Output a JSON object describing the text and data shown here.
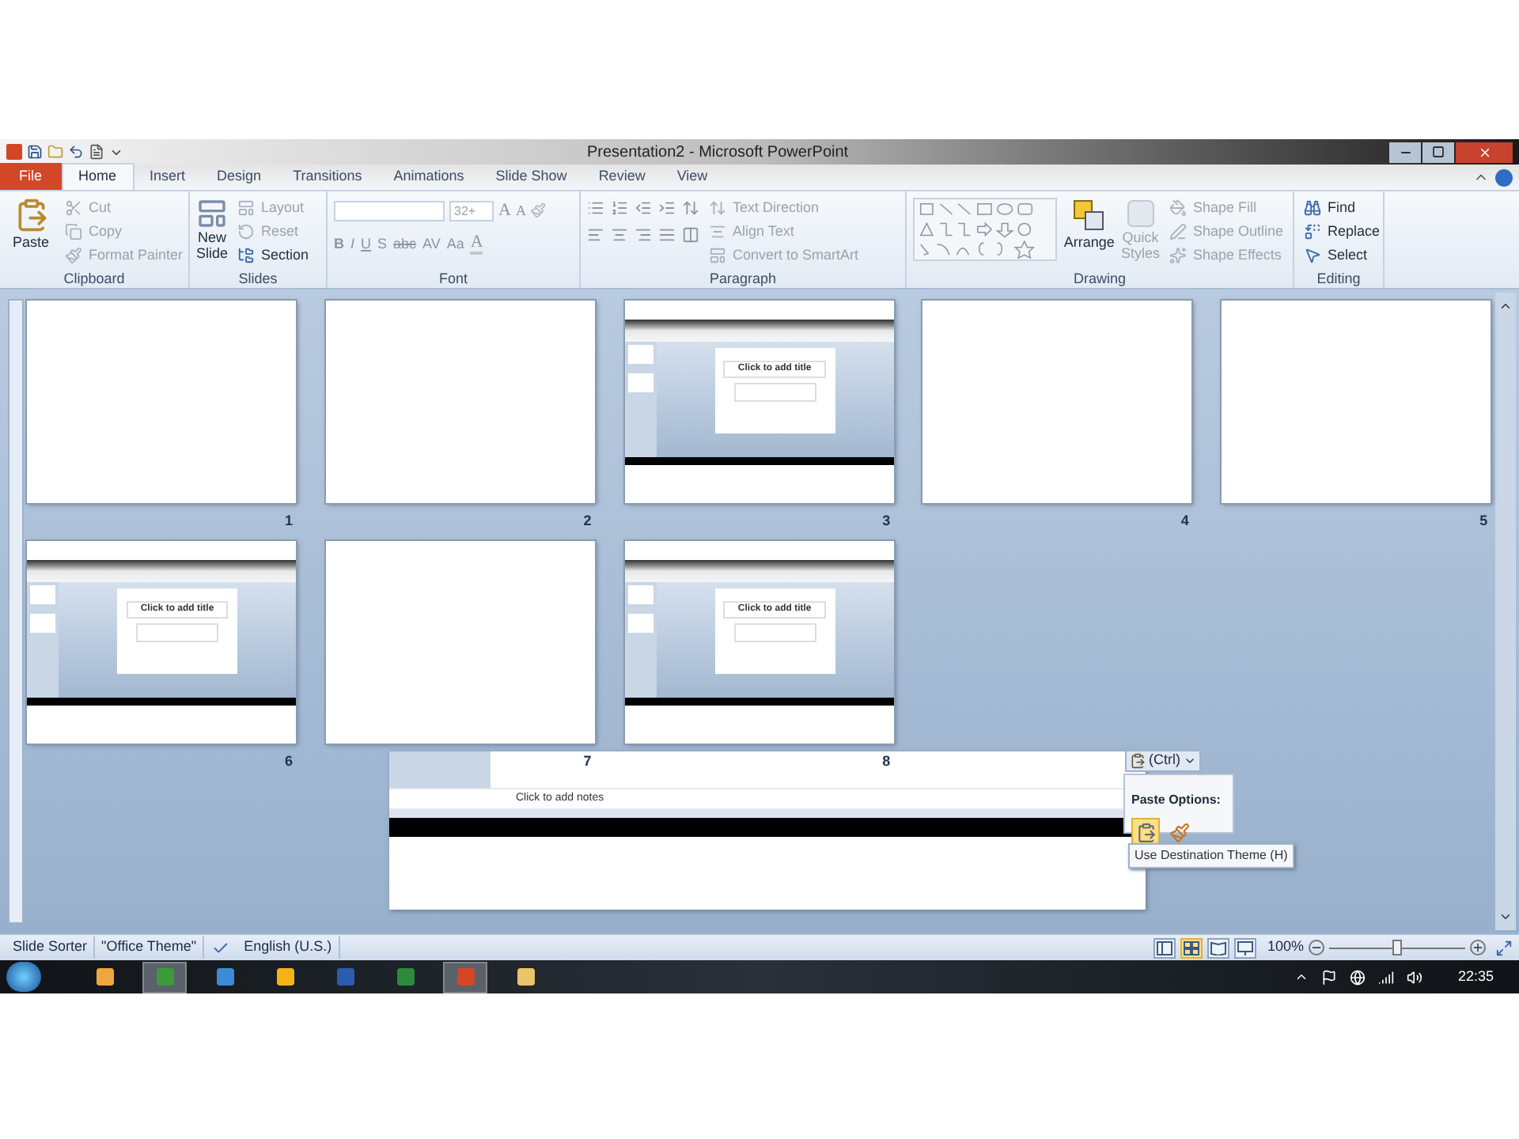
{
  "window": {
    "title": "Presentation2 - Microsoft PowerPoint"
  },
  "tabs": [
    {
      "label": "File",
      "kind": "file",
      "selected": false
    },
    {
      "label": "Home",
      "kind": "tab",
      "selected": true
    },
    {
      "label": "Insert",
      "kind": "tab",
      "selected": false
    },
    {
      "label": "Design",
      "kind": "tab",
      "selected": false
    },
    {
      "label": "Transitions",
      "kind": "tab",
      "selected": false
    },
    {
      "label": "Animations",
      "kind": "tab",
      "selected": false
    },
    {
      "label": "Slide Show",
      "kind": "tab",
      "selected": false
    },
    {
      "label": "Review",
      "kind": "tab",
      "selected": false
    },
    {
      "label": "View",
      "kind": "tab",
      "selected": false
    }
  ],
  "ribbon": {
    "clipboard": {
      "label": "Clipboard",
      "paste": "Paste",
      "items": [
        {
          "label": "Cut",
          "disabled": true
        },
        {
          "label": "Copy",
          "disabled": true
        },
        {
          "label": "Format Painter",
          "disabled": true
        }
      ]
    },
    "slides": {
      "label": "Slides",
      "new_slide": [
        "New",
        "Slide"
      ],
      "items": [
        {
          "label": "Layout",
          "disabled": true
        },
        {
          "label": "Reset",
          "disabled": true
        },
        {
          "label": "Section",
          "disabled": false
        }
      ]
    },
    "font": {
      "label": "Font",
      "size": "32+",
      "size_buttons": [
        "A",
        "A"
      ],
      "format_buttons": [
        "B",
        "I",
        "U",
        "S",
        "abc",
        "AV",
        "Aa"
      ],
      "color_button": "A"
    },
    "paragraph": {
      "label": "Paragraph",
      "items": [
        {
          "label": "Text Direction",
          "disabled": true
        },
        {
          "label": "Align Text",
          "disabled": true
        },
        {
          "label": "Convert to SmartArt",
          "disabled": true
        }
      ]
    },
    "drawing": {
      "label": "Drawing",
      "arrange": "Arrange",
      "quick_styles": [
        "Quick",
        "Styles"
      ],
      "items": [
        {
          "label": "Shape Fill",
          "disabled": true
        },
        {
          "label": "Shape Outline",
          "disabled": true
        },
        {
          "label": "Shape Effects",
          "disabled": true
        }
      ]
    },
    "editing": {
      "label": "Editing",
      "items": [
        {
          "label": "Find",
          "disabled": false
        },
        {
          "label": "Replace",
          "disabled": false
        },
        {
          "label": "Select",
          "disabled": false
        }
      ]
    }
  },
  "slides": [
    {
      "number": "1",
      "kind": "blank"
    },
    {
      "number": "2",
      "kind": "blank"
    },
    {
      "number": "3",
      "kind": "screenshot",
      "title": "Click to add title"
    },
    {
      "number": "4",
      "kind": "blank"
    },
    {
      "number": "5",
      "kind": "blank"
    },
    {
      "number": "6",
      "kind": "screenshot",
      "title": "Click to add title"
    },
    {
      "number": "7",
      "kind": "blank"
    },
    {
      "number": "8",
      "kind": "screenshot",
      "title": "Click to add title"
    }
  ],
  "ghost_window": {
    "notes": "Click to add notes"
  },
  "paste_button": {
    "label": "(Ctrl)"
  },
  "paste_options": {
    "title": "Paste Options:",
    "options": [
      {
        "kind": "theme",
        "selected": true
      },
      {
        "kind": "source",
        "selected": false
      }
    ],
    "tooltip": "Use Destination Theme (H)"
  },
  "status_bar": {
    "items": [
      "Slide Sorter",
      "\"Office Theme\"",
      "English (U.S.)"
    ],
    "views": [
      {
        "kind": "normal",
        "selected": false
      },
      {
        "kind": "sorter",
        "selected": true
      },
      {
        "kind": "reading",
        "selected": false
      },
      {
        "kind": "show",
        "selected": false
      }
    ],
    "zoom": "100%",
    "zoom_slider": {
      "level": 0.5
    }
  },
  "taskbar": {
    "apps": [
      {
        "kind": "media",
        "selected": false
      },
      {
        "kind": "chrome",
        "selected": true
      },
      {
        "kind": "ie",
        "selected": false
      },
      {
        "kind": "outlook",
        "selected": false
      },
      {
        "kind": "word",
        "selected": false
      },
      {
        "kind": "excel",
        "selected": false
      },
      {
        "kind": "powerpoint",
        "selected": true
      },
      {
        "kind": "explorer",
        "selected": false
      }
    ],
    "clock": "22:35"
  }
}
